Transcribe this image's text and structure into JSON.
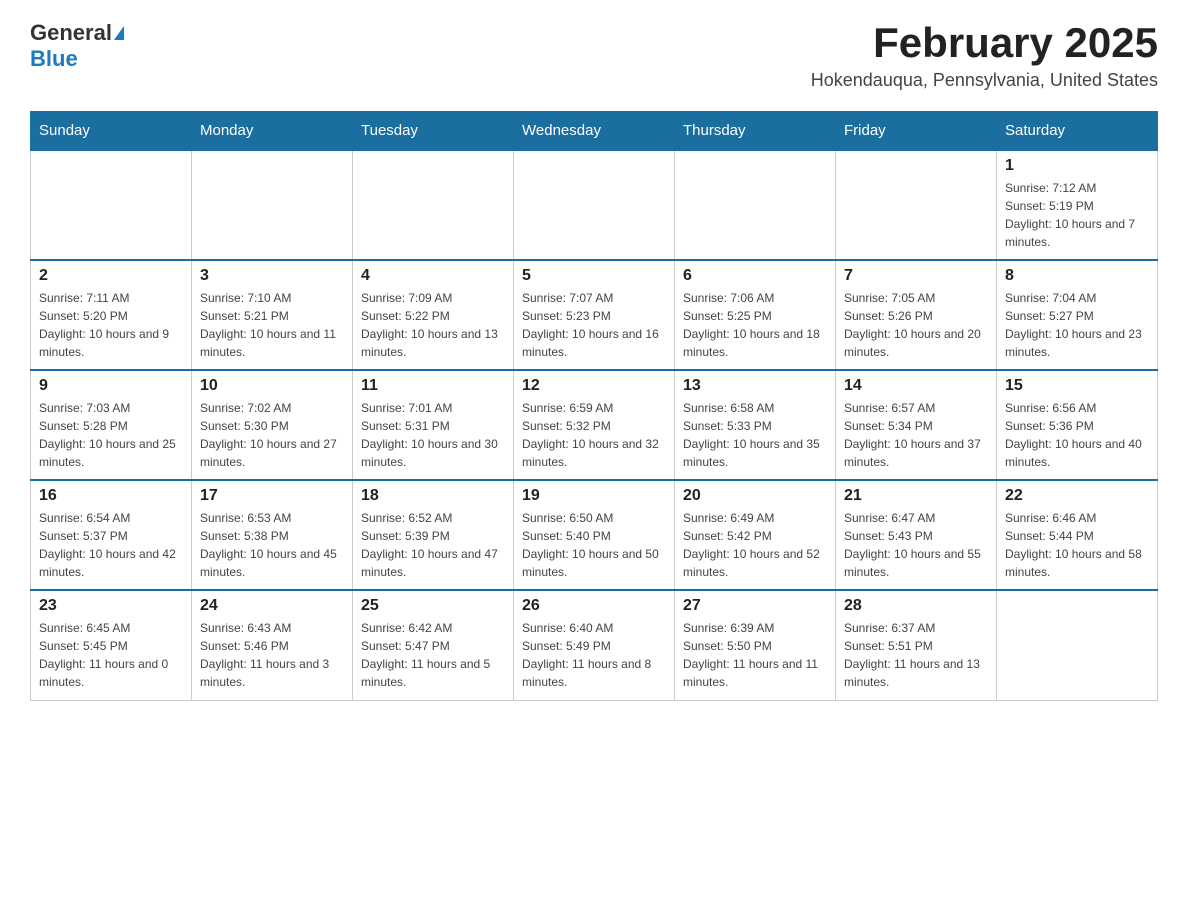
{
  "logo": {
    "general": "General",
    "blue": "Blue"
  },
  "title": "February 2025",
  "location": "Hokendauqua, Pennsylvania, United States",
  "days_of_week": [
    "Sunday",
    "Monday",
    "Tuesday",
    "Wednesday",
    "Thursday",
    "Friday",
    "Saturday"
  ],
  "weeks": [
    [
      {
        "day": "",
        "info": ""
      },
      {
        "day": "",
        "info": ""
      },
      {
        "day": "",
        "info": ""
      },
      {
        "day": "",
        "info": ""
      },
      {
        "day": "",
        "info": ""
      },
      {
        "day": "",
        "info": ""
      },
      {
        "day": "1",
        "info": "Sunrise: 7:12 AM\nSunset: 5:19 PM\nDaylight: 10 hours and 7 minutes."
      }
    ],
    [
      {
        "day": "2",
        "info": "Sunrise: 7:11 AM\nSunset: 5:20 PM\nDaylight: 10 hours and 9 minutes."
      },
      {
        "day": "3",
        "info": "Sunrise: 7:10 AM\nSunset: 5:21 PM\nDaylight: 10 hours and 11 minutes."
      },
      {
        "day": "4",
        "info": "Sunrise: 7:09 AM\nSunset: 5:22 PM\nDaylight: 10 hours and 13 minutes."
      },
      {
        "day": "5",
        "info": "Sunrise: 7:07 AM\nSunset: 5:23 PM\nDaylight: 10 hours and 16 minutes."
      },
      {
        "day": "6",
        "info": "Sunrise: 7:06 AM\nSunset: 5:25 PM\nDaylight: 10 hours and 18 minutes."
      },
      {
        "day": "7",
        "info": "Sunrise: 7:05 AM\nSunset: 5:26 PM\nDaylight: 10 hours and 20 minutes."
      },
      {
        "day": "8",
        "info": "Sunrise: 7:04 AM\nSunset: 5:27 PM\nDaylight: 10 hours and 23 minutes."
      }
    ],
    [
      {
        "day": "9",
        "info": "Sunrise: 7:03 AM\nSunset: 5:28 PM\nDaylight: 10 hours and 25 minutes."
      },
      {
        "day": "10",
        "info": "Sunrise: 7:02 AM\nSunset: 5:30 PM\nDaylight: 10 hours and 27 minutes."
      },
      {
        "day": "11",
        "info": "Sunrise: 7:01 AM\nSunset: 5:31 PM\nDaylight: 10 hours and 30 minutes."
      },
      {
        "day": "12",
        "info": "Sunrise: 6:59 AM\nSunset: 5:32 PM\nDaylight: 10 hours and 32 minutes."
      },
      {
        "day": "13",
        "info": "Sunrise: 6:58 AM\nSunset: 5:33 PM\nDaylight: 10 hours and 35 minutes."
      },
      {
        "day": "14",
        "info": "Sunrise: 6:57 AM\nSunset: 5:34 PM\nDaylight: 10 hours and 37 minutes."
      },
      {
        "day": "15",
        "info": "Sunrise: 6:56 AM\nSunset: 5:36 PM\nDaylight: 10 hours and 40 minutes."
      }
    ],
    [
      {
        "day": "16",
        "info": "Sunrise: 6:54 AM\nSunset: 5:37 PM\nDaylight: 10 hours and 42 minutes."
      },
      {
        "day": "17",
        "info": "Sunrise: 6:53 AM\nSunset: 5:38 PM\nDaylight: 10 hours and 45 minutes."
      },
      {
        "day": "18",
        "info": "Sunrise: 6:52 AM\nSunset: 5:39 PM\nDaylight: 10 hours and 47 minutes."
      },
      {
        "day": "19",
        "info": "Sunrise: 6:50 AM\nSunset: 5:40 PM\nDaylight: 10 hours and 50 minutes."
      },
      {
        "day": "20",
        "info": "Sunrise: 6:49 AM\nSunset: 5:42 PM\nDaylight: 10 hours and 52 minutes."
      },
      {
        "day": "21",
        "info": "Sunrise: 6:47 AM\nSunset: 5:43 PM\nDaylight: 10 hours and 55 minutes."
      },
      {
        "day": "22",
        "info": "Sunrise: 6:46 AM\nSunset: 5:44 PM\nDaylight: 10 hours and 58 minutes."
      }
    ],
    [
      {
        "day": "23",
        "info": "Sunrise: 6:45 AM\nSunset: 5:45 PM\nDaylight: 11 hours and 0 minutes."
      },
      {
        "day": "24",
        "info": "Sunrise: 6:43 AM\nSunset: 5:46 PM\nDaylight: 11 hours and 3 minutes."
      },
      {
        "day": "25",
        "info": "Sunrise: 6:42 AM\nSunset: 5:47 PM\nDaylight: 11 hours and 5 minutes."
      },
      {
        "day": "26",
        "info": "Sunrise: 6:40 AM\nSunset: 5:49 PM\nDaylight: 11 hours and 8 minutes."
      },
      {
        "day": "27",
        "info": "Sunrise: 6:39 AM\nSunset: 5:50 PM\nDaylight: 11 hours and 11 minutes."
      },
      {
        "day": "28",
        "info": "Sunrise: 6:37 AM\nSunset: 5:51 PM\nDaylight: 11 hours and 13 minutes."
      },
      {
        "day": "",
        "info": ""
      }
    ]
  ]
}
